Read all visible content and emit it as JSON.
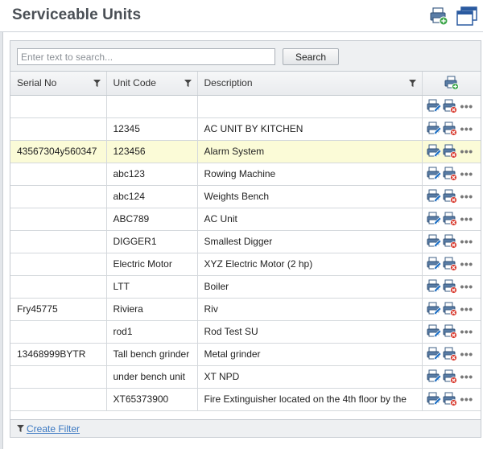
{
  "header": {
    "title": "Serviceable Units",
    "print_icon": "printer-add-icon",
    "window_icon": "new-window-icon"
  },
  "search": {
    "placeholder": "Enter text to search...",
    "value": "",
    "button_label": "Search"
  },
  "columns": [
    {
      "label": "Serial No"
    },
    {
      "label": "Unit Code"
    },
    {
      "label": "Description"
    }
  ],
  "rows": [
    {
      "serial": "",
      "code": "",
      "description": ""
    },
    {
      "serial": "",
      "code": "12345",
      "description": "AC UNIT BY KITCHEN"
    },
    {
      "serial": "43567304y560347",
      "code": "123456",
      "description": "Alarm System",
      "highlighted": true
    },
    {
      "serial": "",
      "code": "abc123",
      "description": "Rowing Machine"
    },
    {
      "serial": "",
      "code": "abc124",
      "description": "Weights Bench"
    },
    {
      "serial": "",
      "code": "ABC789",
      "description": "AC Unit"
    },
    {
      "serial": "",
      "code": "DIGGER1",
      "description": "Smallest Digger"
    },
    {
      "serial": "",
      "code": "Electric Motor",
      "description": "XYZ Electric Motor (2 hp)"
    },
    {
      "serial": "",
      "code": "LTT",
      "description": "Boiler"
    },
    {
      "serial": "Fry45775",
      "code": "Riviera",
      "description": "Riv"
    },
    {
      "serial": "",
      "code": "rod1",
      "description": "Rod Test SU"
    },
    {
      "serial": "13468999BYTR",
      "code": "Tall bench grinder",
      "description": "Metal grinder"
    },
    {
      "serial": "",
      "code": "under bench unit",
      "description": "XT NPD"
    },
    {
      "serial": "",
      "code": "XT65373900",
      "description": "Fire Extinguisher located on the 4th floor by the"
    }
  ],
  "footer": {
    "link_label": "Create Filter"
  },
  "colors": {
    "highlight": "#fbfbd7",
    "link": "#3a78c2",
    "title": "#4a4f55"
  }
}
